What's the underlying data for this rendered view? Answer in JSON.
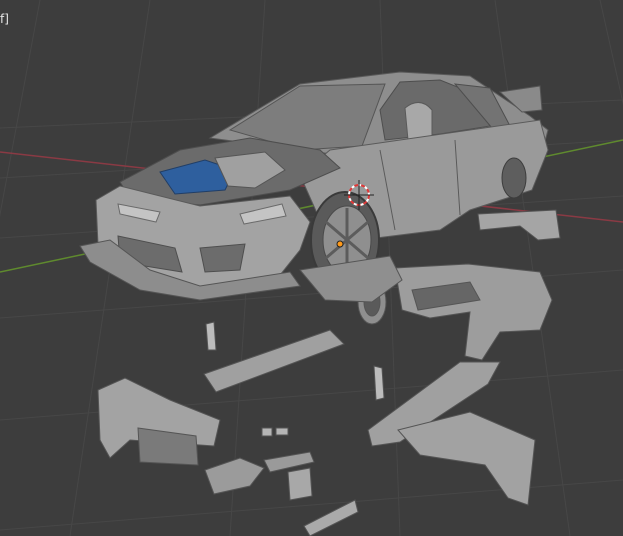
{
  "viewport": {
    "overlay_text": "f]",
    "colors": {
      "background": "#3d3d3d",
      "grid": "#474747",
      "axis_x": "#8a3a44",
      "axis_y": "#5f8a2e",
      "mesh": "#9c9c9c",
      "mesh_dark": "#6e6e6e",
      "mesh_shadow": "#4e4e4e",
      "engine_accent": "#2e5f9e",
      "cursor_red": "#e03838",
      "origin_orange": "#ff9a1a"
    }
  }
}
